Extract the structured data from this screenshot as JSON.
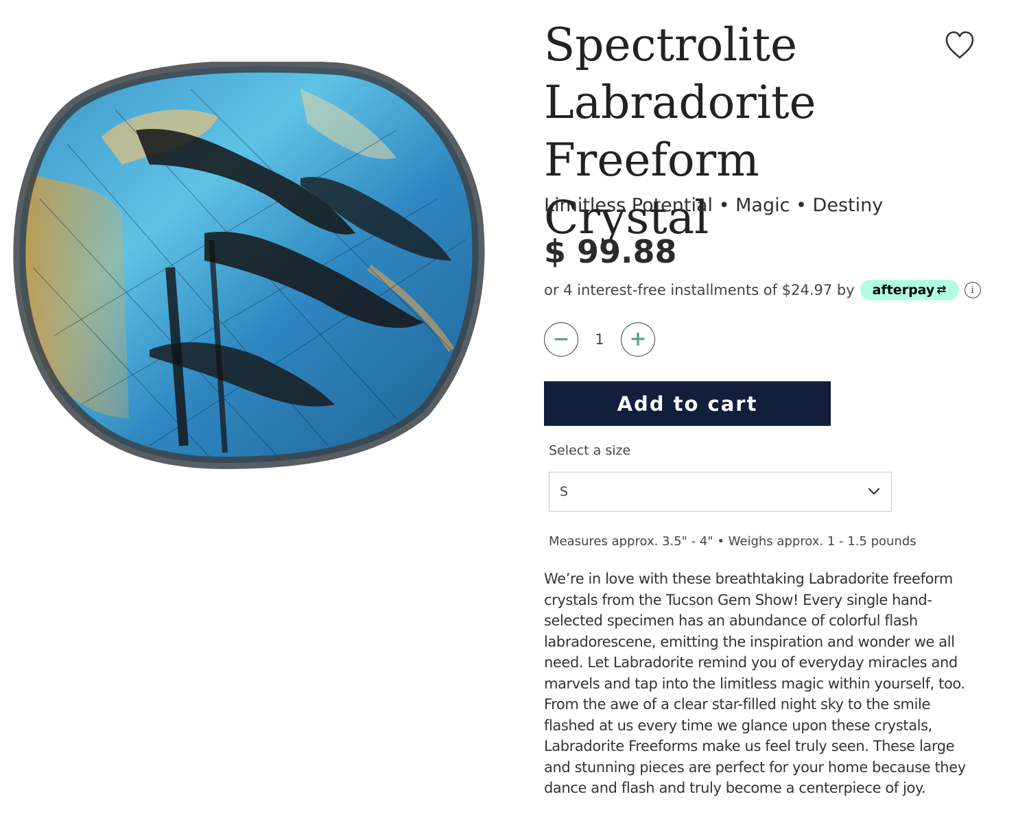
{
  "product": {
    "title": "Spectrolite Labradorite Freeform Crystal",
    "subtitle": "Limitless Potential • Magic • Destiny",
    "price": "$ 99.88",
    "installments_text": "or 4 interest-free installments of $24.97 by",
    "afterpay_label": "afterpay",
    "afterpay_arrows": "⇄",
    "info_icon_glyph": "i",
    "quantity": {
      "minus": "−",
      "value": "1",
      "plus": "+"
    },
    "add_to_cart_label": "Add to cart",
    "size": {
      "label": "Select a size",
      "selected": "S"
    },
    "measures": "Measures approx. 3.5\" - 4\" • Weighs approx. 1 - 1.5 pounds",
    "description": "We’re in love with these breathtaking Labradorite freeform crystals from the Tucson Gem Show! Every single hand-selected specimen has an abundance of colorful flash labradorescene, emitting the inspiration and wonder we all need. Let Labradorite remind you of everyday miracles and marvels and tap into the limitless magic within yourself, too. From the awe of a clear star-filled night sky to the smile flashed at us every time we glance upon these crystals, Labradorite Freeforms make us feel truly seen. These large and stunning pieces are perfect for your home because they dance and flash and truly become a centerpiece of joy."
  },
  "icons": {
    "wishlist": "heart-icon",
    "dropdown": "chevron-down-icon",
    "info": "info-icon"
  },
  "colors": {
    "cart_button": "#111f3d",
    "afterpay_badge": "#b2fce4",
    "quantity_accent": "#5ea58a"
  }
}
